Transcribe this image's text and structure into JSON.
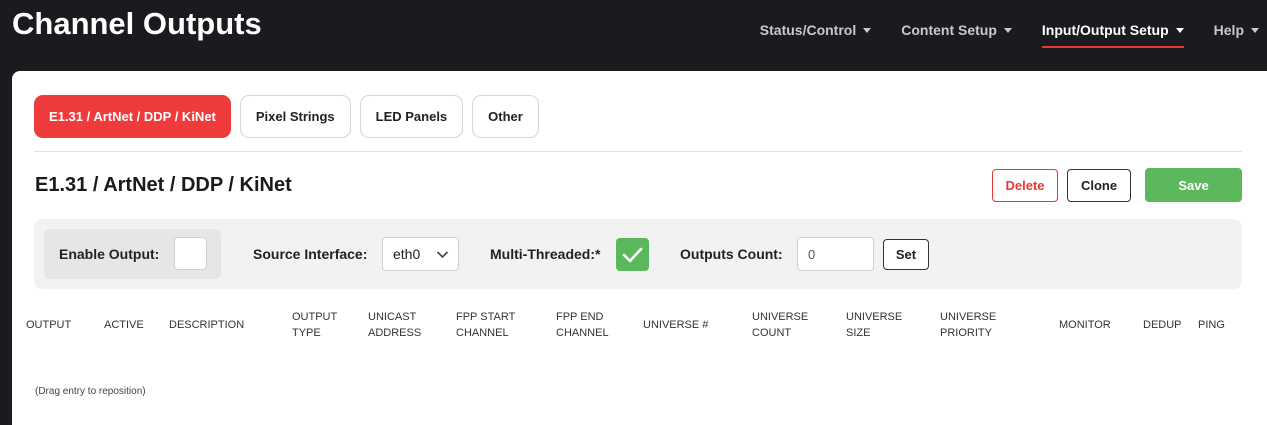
{
  "header": {
    "title": "Channel Outputs",
    "nav": [
      {
        "label": "Status/Control",
        "active": false
      },
      {
        "label": "Content Setup",
        "active": false
      },
      {
        "label": "Input/Output Setup",
        "active": true
      },
      {
        "label": "Help",
        "active": false
      }
    ]
  },
  "tabs": [
    {
      "label": "E1.31 / ArtNet / DDP / KiNet",
      "active": true
    },
    {
      "label": "Pixel Strings",
      "active": false
    },
    {
      "label": "LED Panels",
      "active": false
    },
    {
      "label": "Other",
      "active": false
    }
  ],
  "section": {
    "title": "E1.31 / ArtNet / DDP / KiNet",
    "delete_label": "Delete",
    "clone_label": "Clone",
    "save_label": "Save"
  },
  "controls": {
    "enable_output_label": "Enable Output:",
    "enable_output_checked": false,
    "source_interface_label": "Source Interface:",
    "source_interface_value": "eth0",
    "multi_threaded_label": "Multi-Threaded:*",
    "multi_threaded_checked": true,
    "outputs_count_label": "Outputs Count:",
    "outputs_count_value": "0",
    "set_label": "Set"
  },
  "table": {
    "columns": [
      [
        "OUTPUT"
      ],
      [
        "ACTIVE"
      ],
      [
        "DESCRIPTION"
      ],
      [
        "OUTPUT",
        "TYPE"
      ],
      [
        "UNICAST",
        "ADDRESS"
      ],
      [
        "FPP START",
        "CHANNEL"
      ],
      [
        "FPP END",
        "CHANNEL"
      ],
      [
        "UNIVERSE #"
      ],
      [
        "UNIVERSE",
        "COUNT"
      ],
      [
        "UNIVERSE",
        "SIZE"
      ],
      [
        "UNIVERSE",
        "PRIORITY"
      ],
      [
        "MONITOR"
      ],
      [
        "DEDUP"
      ],
      [
        "PING"
      ]
    ],
    "hint": "(Drag entry to reposition)"
  },
  "colors": {
    "header_bg": "#1b1b1f",
    "active_tab": "#ef3b3b",
    "save_green": "#5cb85c",
    "delete_red": "#e53935"
  }
}
